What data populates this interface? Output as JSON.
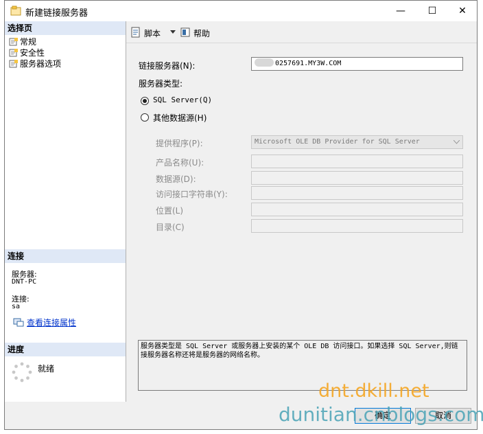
{
  "window": {
    "title": "新建链接服务器",
    "min": "—",
    "max": "☐",
    "close": "✕"
  },
  "left": {
    "select_page_header": "选择页",
    "pages": [
      {
        "label": "常规"
      },
      {
        "label": "安全性"
      },
      {
        "label": "服务器选项"
      }
    ],
    "connection_header": "连接",
    "server_label": "服务器:",
    "server_value": "DNT-PC",
    "conn_label": "连接:",
    "conn_value": "sa",
    "view_props_link": "查看连接属性",
    "progress_header": "进度",
    "progress_status": "就绪"
  },
  "toolbar": {
    "script_label": "脚本",
    "help_label": "帮助"
  },
  "form": {
    "linked_server_label": "链接服务器(N):",
    "linked_server_value": "0257691.MY3W.COM",
    "server_type_label": "服务器类型:",
    "radio_sql": "SQL Server(Q)",
    "radio_other": "其他数据源(H)",
    "provider_label": "提供程序(P):",
    "provider_value": "Microsoft OLE DB Provider for SQL Server",
    "product_label": "产品名称(U):",
    "datasource_label": "数据源(D):",
    "provstr_label": "访问接口字符串(Y):",
    "location_label": "位置(L)",
    "catalog_label": "目录(C)",
    "description": "服务器类型是 SQL Server 或服务器上安装的某个 OLE DB 访问接口。如果选择 SQL Server,则链接服务器名称还将是服务器的网络名称。"
  },
  "buttons": {
    "ok": "确定",
    "cancel": "取消"
  },
  "watermarks": {
    "line1": "dnt.dkill.net",
    "line2": "dunitian.cnblogs.com"
  },
  "colors": {
    "section_header": "#dfe8f6",
    "link": "#0033cc",
    "watermark1": "#f5a623",
    "watermark2": "#4aa3b6"
  }
}
